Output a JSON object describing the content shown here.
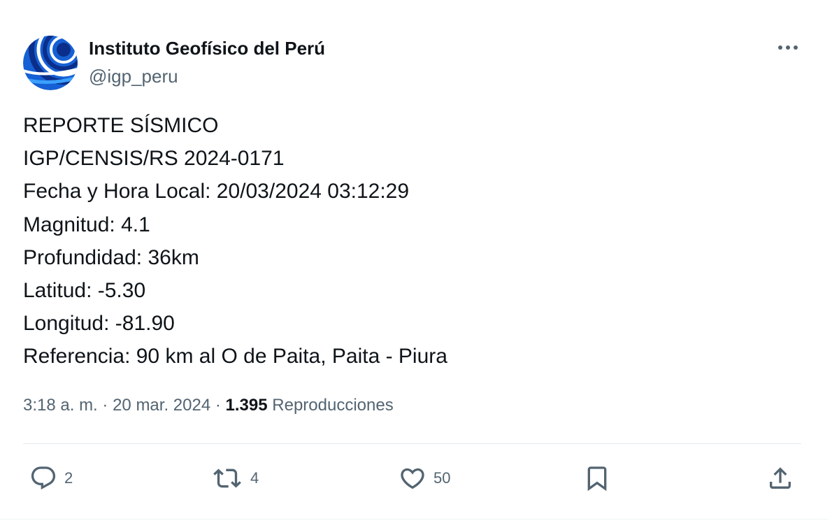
{
  "author": {
    "name": "Instituto Geofísico del Perú",
    "handle": "@igp_peru",
    "avatar_icon": "igp-logo-icon"
  },
  "post": {
    "lines": [
      "REPORTE SÍSMICO",
      "IGP/CENSIS/RS 2024-0171",
      "Fecha y Hora Local: 20/03/2024 03:12:29",
      "Magnitud: 4.1",
      "Profundidad: 36km",
      "Latitud: -5.30",
      "Longitud: -81.90",
      "Referencia: 90 km al O de Paita, Paita - Piura"
    ],
    "time": "3:18 a. m.",
    "separator": "·",
    "date": "20 mar. 2024",
    "views_count": "1.395",
    "views_label": "Reproducciones"
  },
  "actions": {
    "replies": "2",
    "reposts": "4",
    "likes": "50"
  },
  "colors": {
    "text": "#0f1419",
    "secondary": "#536471",
    "divider": "#e6ebee",
    "logo_blue": "#1e6fd9",
    "logo_navy": "#0b2e8a"
  }
}
